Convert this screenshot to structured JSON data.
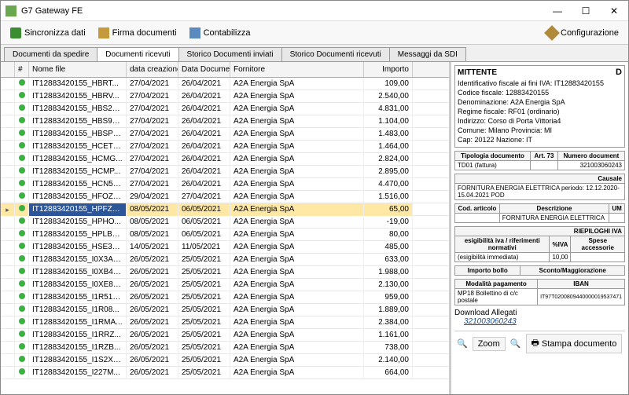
{
  "window": {
    "title": "G7 Gateway FE"
  },
  "toolbar": {
    "sync": "Sincronizza dati",
    "sign": "Firma documenti",
    "account": "Contabilizza",
    "config": "Configurazione"
  },
  "tabs": [
    {
      "label": "Documenti da spedire"
    },
    {
      "label": "Documenti ricevuti",
      "active": true
    },
    {
      "label": "Storico Documenti inviati"
    },
    {
      "label": "Storico Documenti ricevuti"
    },
    {
      "label": "Messaggi da SDI"
    }
  ],
  "grid": {
    "headers": [
      "",
      "#",
      "Nome file",
      "data creazione",
      "Data Documento",
      "Fornitore",
      "Importo"
    ],
    "rows": [
      {
        "file": "IT12883420155_HBRT...",
        "cre": "27/04/2021",
        "doc": "26/04/2021",
        "forn": "A2A Energia SpA",
        "imp": "109,00"
      },
      {
        "file": "IT12883420155_HBRV...",
        "cre": "27/04/2021",
        "doc": "26/04/2021",
        "forn": "A2A Energia SpA",
        "imp": "2.540,00"
      },
      {
        "file": "IT12883420155_HBS2E...",
        "cre": "27/04/2021",
        "doc": "26/04/2021",
        "forn": "A2A Energia SpA",
        "imp": "4.831,00"
      },
      {
        "file": "IT12883420155_HBS9V...",
        "cre": "27/04/2021",
        "doc": "26/04/2021",
        "forn": "A2A Energia SpA",
        "imp": "1.104,00"
      },
      {
        "file": "IT12883420155_HBSP6...",
        "cre": "27/04/2021",
        "doc": "26/04/2021",
        "forn": "A2A Energia SpA",
        "imp": "1.483,00"
      },
      {
        "file": "IT12883420155_HCETY...",
        "cre": "27/04/2021",
        "doc": "26/04/2021",
        "forn": "A2A Energia SpA",
        "imp": "1.464,00"
      },
      {
        "file": "IT12883420155_HCMG...",
        "cre": "27/04/2021",
        "doc": "26/04/2021",
        "forn": "A2A Energia SpA",
        "imp": "2.824,00"
      },
      {
        "file": "IT12883420155_HCMP...",
        "cre": "27/04/2021",
        "doc": "26/04/2021",
        "forn": "A2A Energia SpA",
        "imp": "2.895,00"
      },
      {
        "file": "IT12883420155_HCN55...",
        "cre": "27/04/2021",
        "doc": "26/04/2021",
        "forn": "A2A Energia SpA",
        "imp": "4.470,00"
      },
      {
        "file": "IT12883420155_HFOZZ...",
        "cre": "29/04/2021",
        "doc": "27/04/2021",
        "forn": "A2A Energia SpA",
        "imp": "1.516,00"
      },
      {
        "file": "IT12883420155_HPFZZ...",
        "cre": "08/05/2021",
        "doc": "06/05/2021",
        "forn": "A2A Energia SpA",
        "imp": "65,00",
        "selected": true
      },
      {
        "file": "IT12883420155_HPHO...",
        "cre": "08/05/2021",
        "doc": "06/05/2021",
        "forn": "A2A Energia SpA",
        "imp": "-19,00"
      },
      {
        "file": "IT12883420155_HPLBP...",
        "cre": "08/05/2021",
        "doc": "06/05/2021",
        "forn": "A2A Energia SpA",
        "imp": "80,00"
      },
      {
        "file": "IT12883420155_HSE3V...",
        "cre": "14/05/2021",
        "doc": "11/05/2021",
        "forn": "A2A Energia SpA",
        "imp": "485,00"
      },
      {
        "file": "IT12883420155_I0X3A.x...",
        "cre": "26/05/2021",
        "doc": "25/05/2021",
        "forn": "A2A Energia SpA",
        "imp": "633,00"
      },
      {
        "file": "IT12883420155_I0XB4.x...",
        "cre": "26/05/2021",
        "doc": "25/05/2021",
        "forn": "A2A Energia SpA",
        "imp": "1.988,00"
      },
      {
        "file": "IT12883420155_I0XE8.x...",
        "cre": "26/05/2021",
        "doc": "25/05/2021",
        "forn": "A2A Energia SpA",
        "imp": "2.130,00"
      },
      {
        "file": "IT12883420155_I1R51.x...",
        "cre": "26/05/2021",
        "doc": "25/05/2021",
        "forn": "A2A Energia SpA",
        "imp": "959,00"
      },
      {
        "file": "IT12883420155_I1R08...",
        "cre": "26/05/2021",
        "doc": "25/05/2021",
        "forn": "A2A Energia SpA",
        "imp": "1.889,00"
      },
      {
        "file": "IT12883420155_I1RMA...",
        "cre": "26/05/2021",
        "doc": "25/05/2021",
        "forn": "A2A Energia SpA",
        "imp": "2.384,00"
      },
      {
        "file": "IT12883420155_I1RRZ...",
        "cre": "26/05/2021",
        "doc": "25/05/2021",
        "forn": "A2A Energia SpA",
        "imp": "1.161,00"
      },
      {
        "file": "IT12883420155_I1RZB...",
        "cre": "26/05/2021",
        "doc": "25/05/2021",
        "forn": "A2A Energia SpA",
        "imp": "738,00"
      },
      {
        "file": "IT12883420155_I1S2X.x...",
        "cre": "26/05/2021",
        "doc": "25/05/2021",
        "forn": "A2A Energia SpA",
        "imp": "2.140,00"
      },
      {
        "file": "IT12883420155_I227M...",
        "cre": "26/05/2021",
        "doc": "25/05/2021",
        "forn": "A2A Energia SpA",
        "imp": "664,00"
      }
    ]
  },
  "detail": {
    "mittente": {
      "title": "MITTENTE",
      "lines": [
        "Identificativo fiscale ai fini IVA: IT12883420155",
        "Codice fiscale: 12883420155",
        "Denominazione: A2A Energia SpA",
        "Regime fiscale: RF01 (ordinario)",
        "Indirizzo: Corso di Porta Vittoria4",
        "Comune: Milano Provincia: MI",
        "Cap: 20122 Nazione: IT"
      ],
      "d_label": "D"
    },
    "tipodoc": {
      "h1": "Tipologia documento",
      "h2": "Art. 73",
      "h3": "Numero document",
      "v1": "TD01 (fattura)",
      "v3": "321003060243"
    },
    "causale": {
      "h": "Causale",
      "v": "FORNITURA ENERGIA ELETTRICA periodo: 12.12.2020-15.04.2021 POD"
    },
    "articolo": {
      "h1": "Cod. articolo",
      "h2": "Descrizione",
      "h3": "UM",
      "v": "FORNITURA ENERGIA ELETTRICA"
    },
    "riep": {
      "title": "RIEPILOGHI IVA",
      "h1": "esigibilità iva / riferimenti normativi",
      "h2": "%IVA",
      "h3": "Spese accessorie",
      "v1": "(esigibilità immediata)",
      "v2": "10,00"
    },
    "bollo": {
      "h1": "Importo bollo",
      "h2": "Sconto/Maggiorazione"
    },
    "pag": {
      "h1": "Modalità pagamento",
      "h2": "IBAN",
      "v1": "MP18 Bollettino di c/c postale",
      "v2": "IT97T0200809440000019537471"
    },
    "download": {
      "label": "Download Allegati",
      "link": "321003060243"
    }
  },
  "bottom": {
    "zoom": "Zoom",
    "print": "Stampa documento"
  }
}
